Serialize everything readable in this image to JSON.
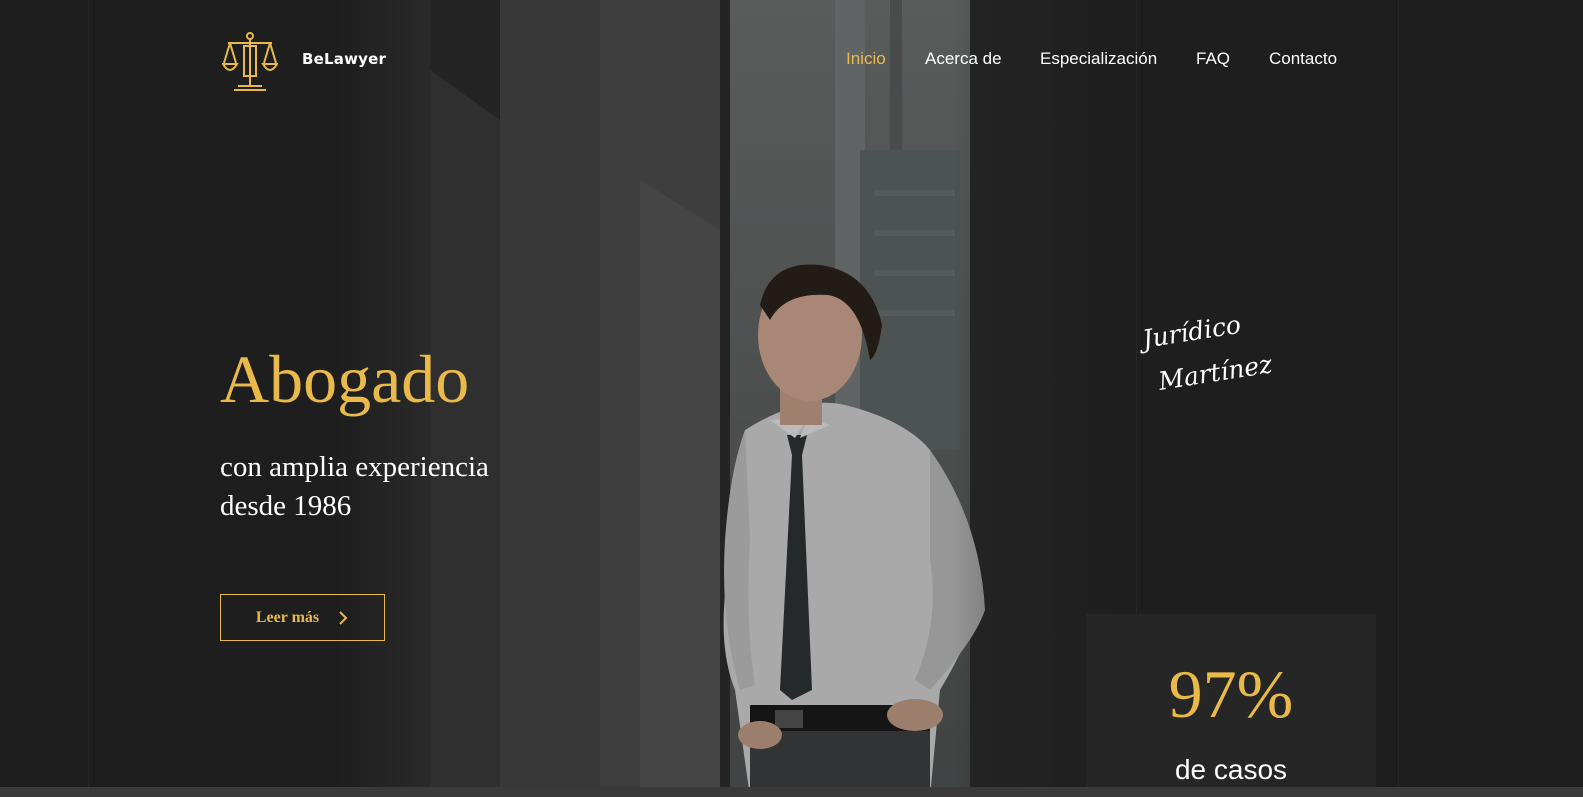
{
  "brand": {
    "name": "BeLawyer",
    "logo_icon": "scales-of-justice-icon",
    "accent_color": "#e9b949"
  },
  "nav": {
    "items": [
      {
        "label": "Inicio",
        "active": true
      },
      {
        "label": "Acerca de",
        "active": false
      },
      {
        "label": "Especialización",
        "active": false
      },
      {
        "label": "FAQ",
        "active": false
      },
      {
        "label": "Contacto",
        "active": false
      }
    ]
  },
  "hero": {
    "title": "Abogado",
    "subtitle_line1": "con amplia experiencia",
    "subtitle_line2": "desde 1986",
    "cta_label": "Leer más",
    "cta_icon": "chevron-right-icon"
  },
  "signature": {
    "line1": "Jurídico",
    "line2": "Martínez"
  },
  "stats": {
    "value": "97%",
    "label": "de casos"
  }
}
